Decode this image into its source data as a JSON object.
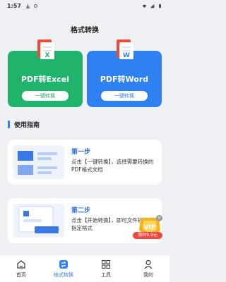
{
  "status_bar": {
    "time": "1:57"
  },
  "header": {
    "title": "格式转换"
  },
  "cards": [
    {
      "title": "PDF转Excel",
      "button": "一键转换",
      "icon_letter": "X",
      "color": "#1fb36c"
    },
    {
      "title": "PDF转Word",
      "button": "一键转换",
      "icon_letter": "W",
      "color": "#2f80f0"
    }
  ],
  "guide": {
    "title": "使用指南",
    "steps": [
      {
        "title": "第一步",
        "desc": "点击【一键转换】，选择需要转换的PDF格式文档"
      },
      {
        "title": "第二步",
        "desc": "点击【开始转换】，即可文件转换成指定格式"
      }
    ]
  },
  "vip": {
    "label": "VIP",
    "price": "限时9.9元",
    "close": "×"
  },
  "tabbar": {
    "items": [
      {
        "label": "首页",
        "icon": "home-icon"
      },
      {
        "label": "格式转换",
        "icon": "convert-icon"
      },
      {
        "label": "工具",
        "icon": "grid-icon"
      },
      {
        "label": "我的",
        "icon": "user-icon"
      }
    ],
    "active_index": 1
  }
}
